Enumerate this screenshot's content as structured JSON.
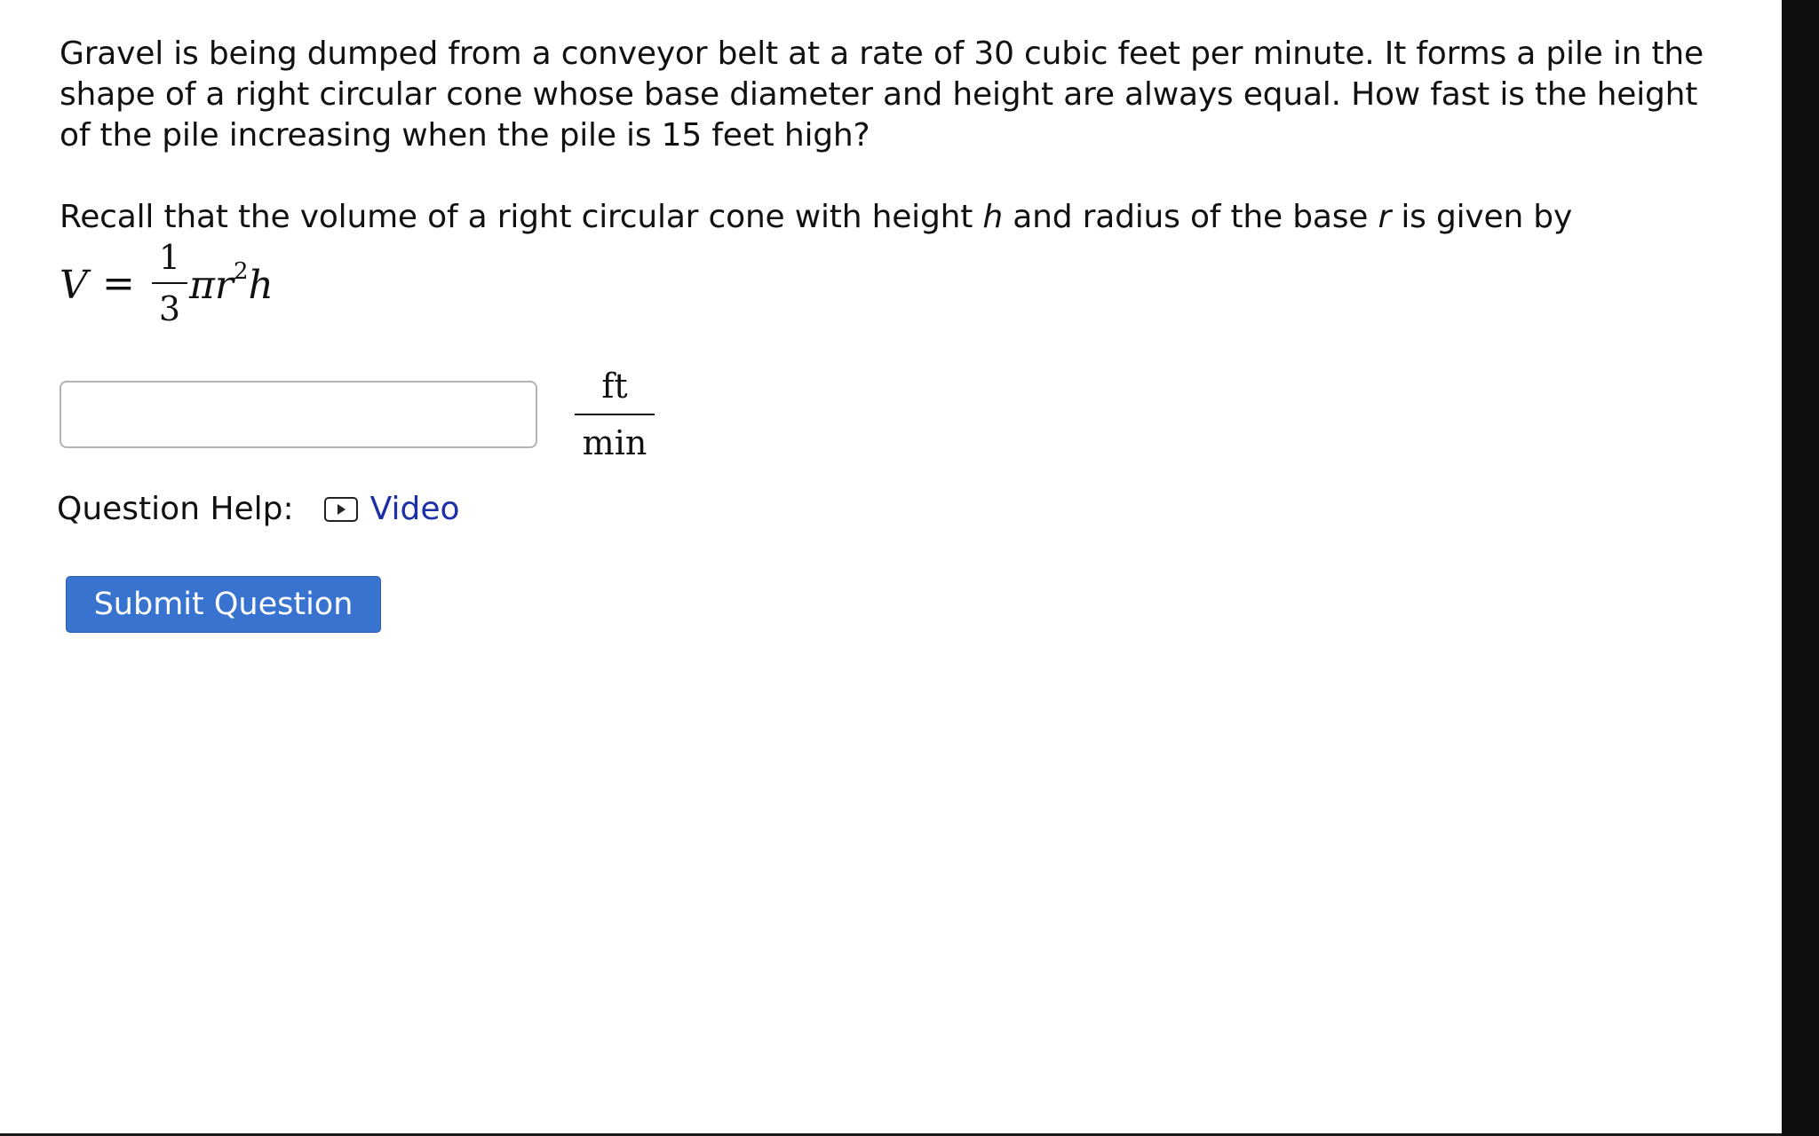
{
  "question": {
    "problem_text": "Gravel is being dumped from a conveyor belt at a rate of 30 cubic feet per minute. It forms a pile in the shape of a right circular cone whose base diameter and height are always equal. How fast is the height of the pile increasing when the pile is 15 feet high?",
    "recall_prefix": "Recall that the volume of a right circular cone with height ",
    "recall_var_h": "h",
    "recall_middle": " and radius of the base ",
    "recall_var_r": "r",
    "recall_suffix": " is given by",
    "formula": {
      "lhs": "V",
      "equals": "=",
      "frac_num": "1",
      "frac_den": "3",
      "rest_pre": "πr",
      "exponent": "2",
      "rest_post": "h"
    }
  },
  "answer": {
    "value": "",
    "placeholder": "",
    "unit_numerator": "ft",
    "unit_denominator": "min"
  },
  "help": {
    "label": "Question Help:",
    "icon": "video-play-icon",
    "link_label": "Video"
  },
  "submit_label": "Submit Question",
  "colors": {
    "button_bg": "#3873cf",
    "link": "#1c2fa6",
    "input_border": "#b4b4b4"
  }
}
